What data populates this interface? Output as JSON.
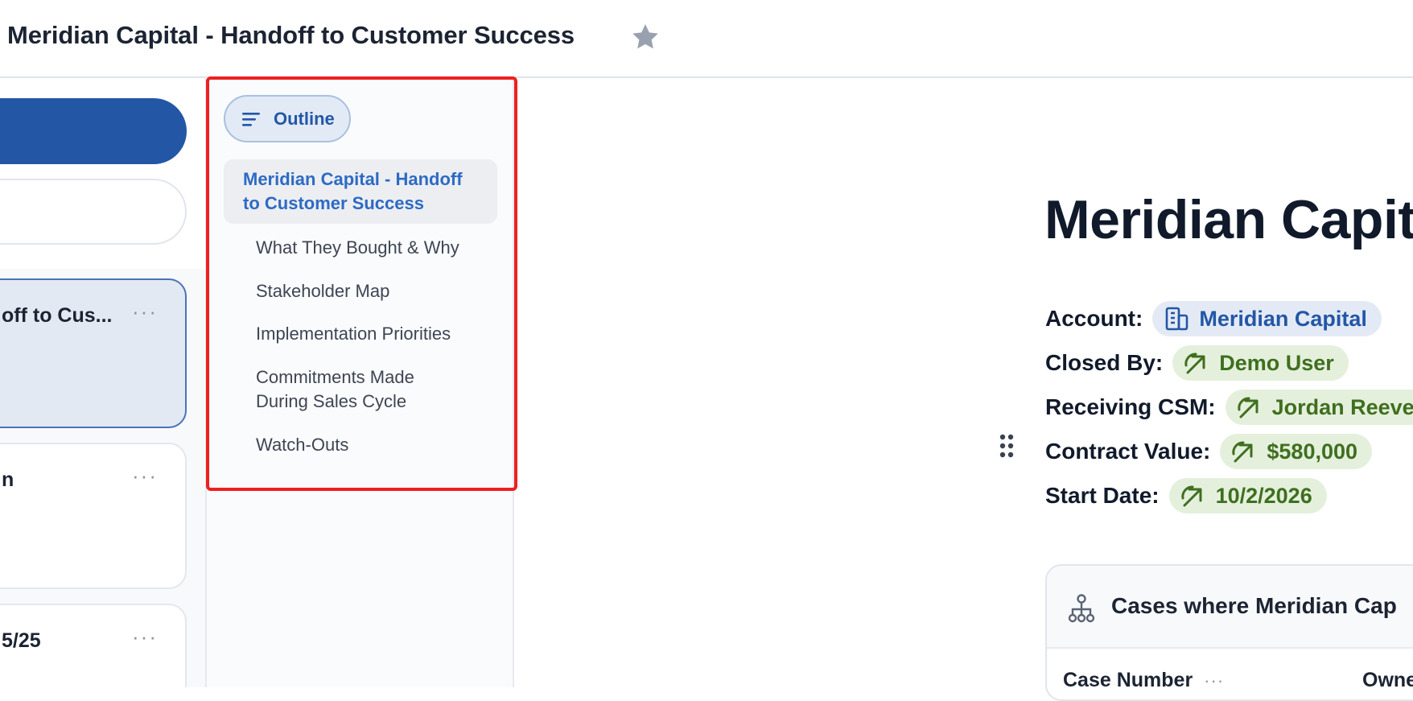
{
  "header": {
    "title": "Meridian Capital - Handoff to Customer Success"
  },
  "doc_list": {
    "cards": [
      {
        "title": "off to Cus...",
        "menu": "···"
      },
      {
        "title": "n",
        "menu": "···"
      },
      {
        "title": "5/25",
        "menu": "···"
      }
    ]
  },
  "outline": {
    "button_label": "Outline",
    "items": [
      {
        "label": "Meridian Capital - Handoff to Customer Success"
      },
      {
        "label": "What They Bought & Why"
      },
      {
        "label": "Stakeholder Map"
      },
      {
        "label": "Implementation Priorities"
      },
      {
        "label": "Commitments Made During Sales Cycle"
      },
      {
        "label": "Watch-Outs"
      }
    ]
  },
  "main": {
    "title": "Meridian Capita",
    "properties": [
      {
        "label": "Account:",
        "value": "Meridian Capital"
      },
      {
        "label": "Closed By:",
        "value": "Demo User"
      },
      {
        "label": "Receiving CSM:",
        "value": "Jordan Reeve"
      },
      {
        "label": "Contract Value:",
        "value": "$580,000"
      },
      {
        "label": "Start Date:",
        "value": "10/2/2026"
      }
    ],
    "cases": {
      "title": "Cases where Meridian Cap",
      "columns": [
        {
          "label": "Case Number",
          "menu": "···"
        },
        {
          "label": "Owne"
        }
      ]
    }
  },
  "colors": {
    "accent": "#2357a6",
    "active_outline_text": "#2e6ac4",
    "chip_green_text": "#3f6f1f",
    "chip_green_bg": "#e4f0dc",
    "chip_blue_bg": "#e4eaf5",
    "highlight_border": "#ee2020"
  },
  "icons": {
    "favorite": "star-icon",
    "outline": "lines-icon",
    "account": "building-icon",
    "link": "arrow-up-right-icon",
    "drag": "drag-handle-icon",
    "hierarchy": "hierarchy-icon"
  }
}
